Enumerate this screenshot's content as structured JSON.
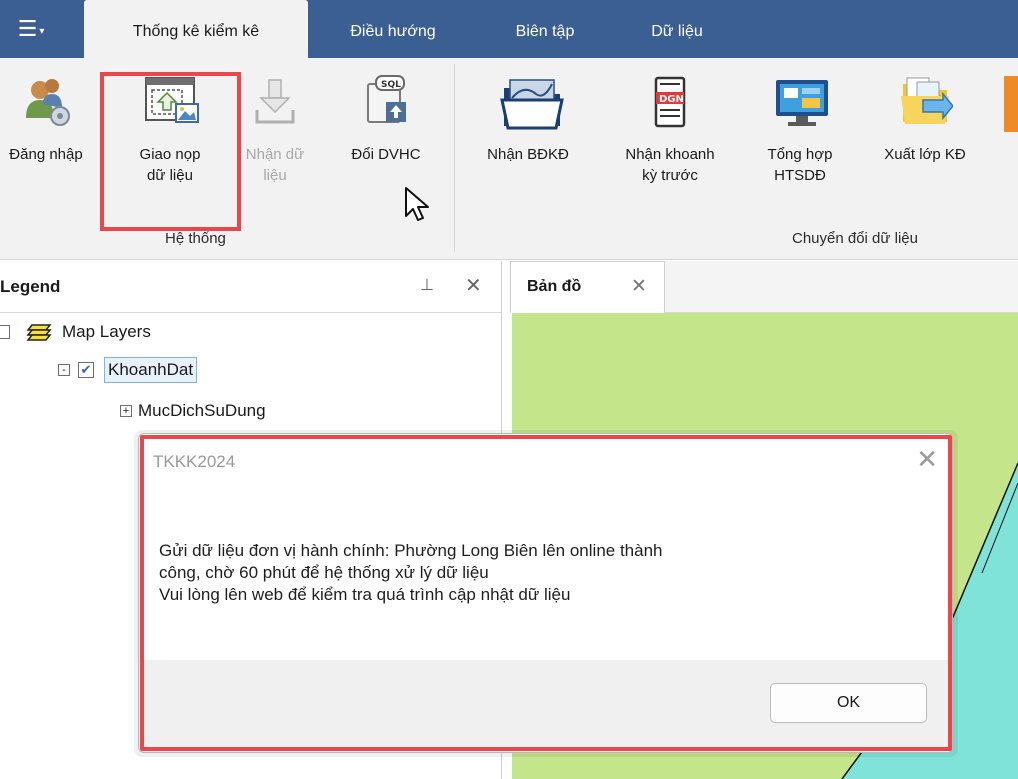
{
  "ribbon": {
    "app_menu_icon": "app-menu-icon",
    "tabs": [
      {
        "label": "Thống kê kiểm kê",
        "active": true
      },
      {
        "label": "Điều hướng",
        "active": false
      },
      {
        "label": "Biên tập",
        "active": false
      },
      {
        "label": "Dữ liệu",
        "active": false
      }
    ],
    "buttons": [
      {
        "label": "Đăng nhập",
        "icon": "login-users-icon",
        "enabled": true
      },
      {
        "label": "Giao nọp\ndữ liệu",
        "icon": "upload-image-icon",
        "enabled": true
      },
      {
        "label": "Nhận dữ\nliệu",
        "icon": "download-icon",
        "enabled": false
      },
      {
        "label": "Đổi DVHC",
        "icon": "sql-upload-icon",
        "enabled": true
      },
      {
        "label": "Nhận BĐKĐ",
        "icon": "folder-map-icon",
        "enabled": true
      },
      {
        "label": "Nhận khoanh\nkỳ trước",
        "icon": "dgn-file-icon",
        "enabled": true
      },
      {
        "label": "Tổng hợp\nHTSDĐ",
        "icon": "monitor-icon",
        "enabled": true
      },
      {
        "label": "Xuất lớp KĐ",
        "icon": "export-folder-icon",
        "enabled": true
      }
    ],
    "groups": [
      {
        "label": "Hệ thống"
      },
      {
        "label": "Chuyển đổi dữ liệu"
      }
    ]
  },
  "legend": {
    "title": "Legend",
    "pin_icon": "pin-icon",
    "close_icon": "close-icon",
    "tree": [
      {
        "label": "Map Layers",
        "expander": "-"
      },
      {
        "label": "KhoanhDat",
        "expander": "-",
        "checked": true,
        "selected": true
      },
      {
        "label": "MucDichSuDung",
        "expander": "+"
      }
    ]
  },
  "map": {
    "tab_label": "Bản đồ",
    "close_icon": "close-icon",
    "colors": {
      "green": "#c5e58a",
      "cyan": "#7fe3da",
      "line": "#111111"
    }
  },
  "dialog": {
    "title": "TKKK2024",
    "message": "Gửi dữ liệu đơn vị hành chính: Phường Long Biên lên online thành\ncông, chờ 60 phút để hệ thống xử lý dữ liệu\nVui lòng lên web để kiểm tra quá trình cập nhật dữ liệu",
    "ok_label": "OK"
  },
  "colors": {
    "tabbar": "#3c5f93",
    "ribbon_bg": "#f2f2f2",
    "highlight": "#e8474c"
  }
}
